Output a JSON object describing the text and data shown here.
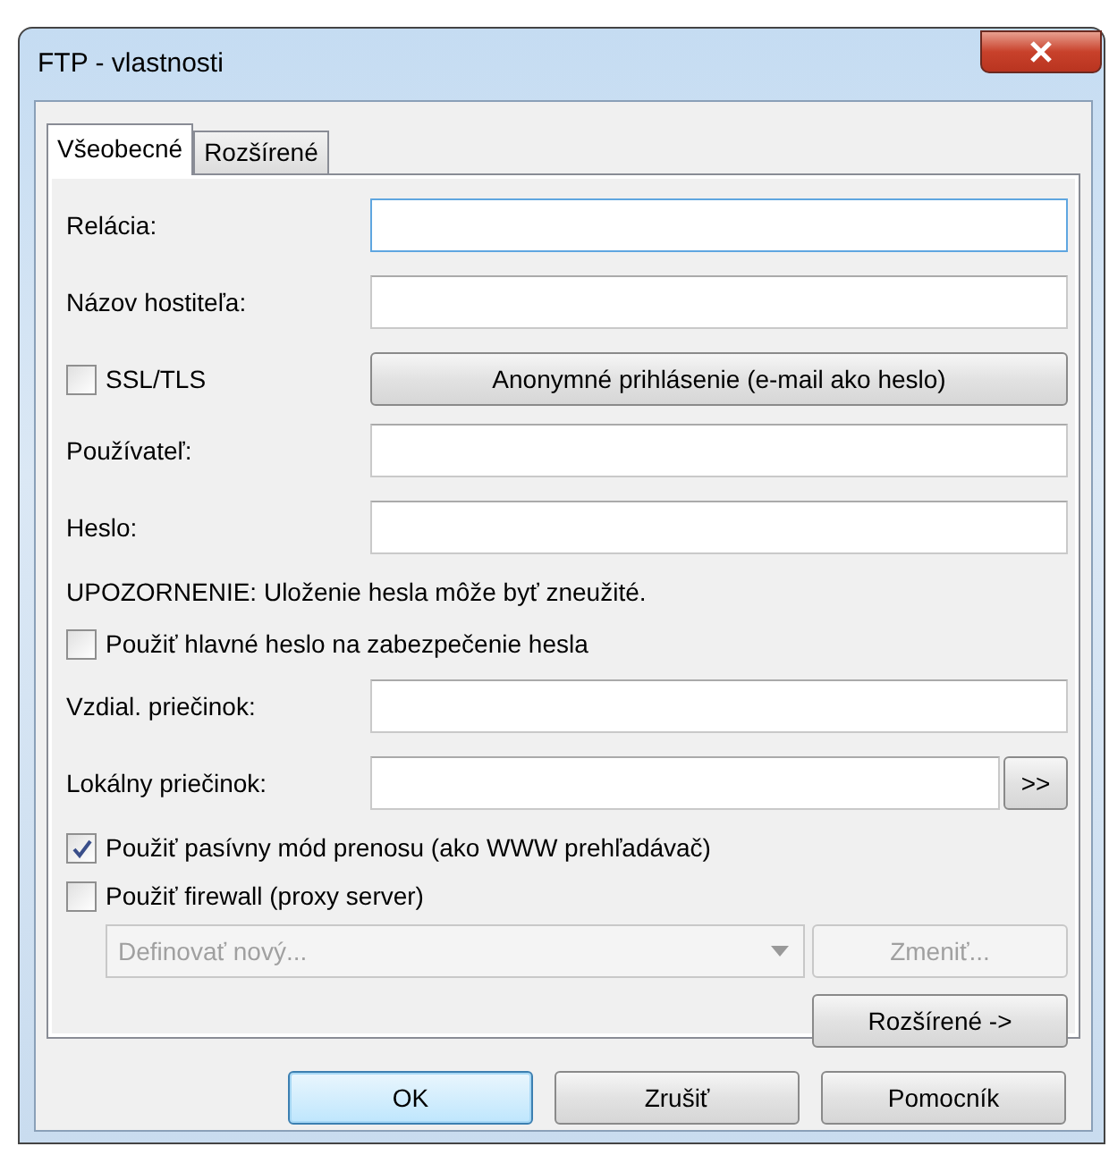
{
  "window": {
    "title": "FTP - vlastnosti"
  },
  "tabs": [
    {
      "label": "Všeobecné",
      "selected": true
    },
    {
      "label": "Rozšírené",
      "selected": false
    }
  ],
  "form": [
    {
      "kind": "field",
      "label": "Relácia:",
      "focused": true
    },
    {
      "kind": "field",
      "label": "Názov hostiteľa:",
      "focused": false
    },
    {
      "kind": "check-button",
      "label": "SSL/TLS",
      "checked": false,
      "button": "Anonymné prihlásenie (e-mail ako heslo)"
    },
    {
      "kind": "field",
      "label": "Používateľ:",
      "focused": false
    },
    {
      "kind": "field",
      "label": "Heslo:",
      "focused": false
    },
    {
      "kind": "note",
      "text": "UPOZORNENIE: Uloženie hesla môže byť zneužité."
    },
    {
      "kind": "check",
      "label": "Použiť hlavné heslo na zabezpečenie hesla",
      "checked": false
    },
    {
      "kind": "field",
      "label": "Vzdial. priečinok:",
      "focused": false
    },
    {
      "kind": "browse-field",
      "label": "Lokálny priečinok:",
      "button": ">>"
    },
    {
      "kind": "check",
      "label": "Použiť pasívny mód prenosu (ako WWW prehľadávač)",
      "checked": true
    },
    {
      "kind": "check",
      "label": "Použiť firewall (proxy server)",
      "checked": false
    },
    {
      "kind": "select",
      "value": "Definovať nový...",
      "button": "Zmeniť...",
      "disabled": true
    },
    {
      "kind": "right-button",
      "button": "Rozšírené ->"
    }
  ],
  "buttons": [
    {
      "label": "OK",
      "default": true
    },
    {
      "label": "Zrušiť",
      "default": false
    },
    {
      "label": "Pomocník",
      "default": false
    }
  ]
}
